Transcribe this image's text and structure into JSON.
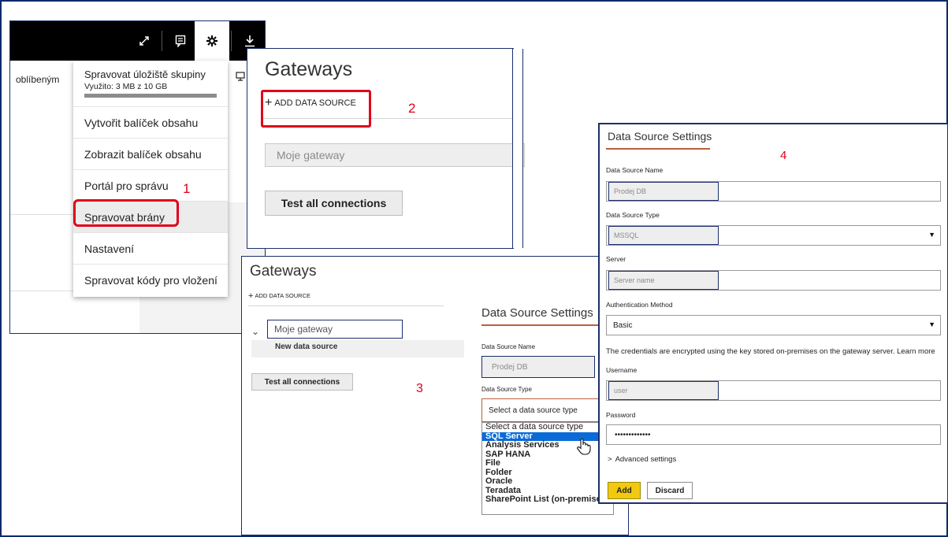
{
  "step_labels": {
    "s1": "1",
    "s2": "2",
    "s3": "3",
    "s4": "4"
  },
  "panel1": {
    "favorites_label": "oblíbeným",
    "toolbar_icons": [
      "expand-icon",
      "comment-icon",
      "gear-icon",
      "download-icon"
    ],
    "menu": {
      "storage_title": "Spravovat úložiště skupiny",
      "storage_used": "Využito: 3 MB z 10 GB",
      "items": [
        "Vytvořit balíček obsahu",
        "Zobrazit balíček obsahu",
        "Portál pro správu",
        "Spravovat brány",
        "Nastavení",
        "Spravovat kódy pro vložení"
      ]
    }
  },
  "panel2": {
    "title": "Gateways",
    "add_data_source": "ADD DATA SOURCE",
    "gateway_name": "Moje gateway",
    "test_button": "Test all connections"
  },
  "panel3": {
    "title": "Gateways",
    "add_data_source": "ADD DATA SOURCE",
    "gateway_name": "Moje gateway",
    "new_data_source": "New data source",
    "test_button": "Test all connections",
    "settings_title": "Data Source Settings",
    "name_label": "Data Source Name",
    "name_value": "Prodej DB",
    "type_label": "Data Source Type",
    "type_placeholder": "Select a data source type",
    "type_options": [
      "Select a data source type",
      "SQL Server",
      "Analysis Services",
      "SAP HANA",
      "File",
      "Folder",
      "Oracle",
      "Teradata",
      "SharePoint List (on-premises)"
    ],
    "selected_option": "SQL Server"
  },
  "panel4": {
    "title": "Data Source Settings",
    "name_label": "Data Source Name",
    "name_value": "Prodej DB",
    "type_label": "Data Source Type",
    "type_value": "MSSQL",
    "server_label": "Server",
    "server_placeholder": "Server name",
    "auth_label": "Authentication Method",
    "auth_value": "Basic",
    "credentials_note": "The credentials are encrypted using the key stored on-premises on the gateway server. Learn more",
    "username_label": "Username",
    "username_value": "user",
    "password_label": "Password",
    "password_value": "•••••••••••••",
    "advanced": "Advanced settings",
    "add_button": "Add",
    "discard_button": "Discard"
  },
  "colors": {
    "accent_red": "#e0001a",
    "frame_navy": "#1c2e6b",
    "add_yellow": "#f2c811",
    "selection_blue": "#0a6ad7",
    "tab_underline": "#b8603a"
  }
}
